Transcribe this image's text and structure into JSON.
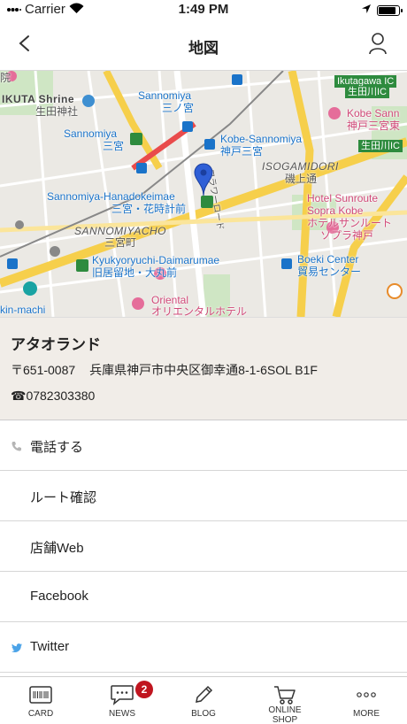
{
  "status_bar": {
    "carrier": "Carrier",
    "time": "1:49 PM",
    "battery_level": 0.9
  },
  "nav": {
    "title": "地図",
    "back_icon": "chevron-left-icon",
    "profile_icon": "person-icon"
  },
  "map": {
    "labels": {
      "ikuta_shrine": "IKUTA Shrine",
      "ikuta_shrine_ja": "生田神社",
      "sannomiya": "Sannomiya",
      "sannomiya_ja": "三ノ宮",
      "sannomiya2": "Sannomiya",
      "sannomiya2_ja": "三宮",
      "kobe_sannomiya": "Kobe-Sannomiya",
      "kobe_sannomiya_ja": "神戸三宮",
      "hanadokeimae": "Sannomiya-Hanadokeimae",
      "hanadokeimae_ja": "三宮・花時計前",
      "sannomiyacho": "SANNOMIYACHO",
      "sannomiyacho_ja": "三宮町",
      "kyukyoryuchi": "Kyukyoryuchi-Daimarumae",
      "kyukyoryuchi_ja": "旧居留地・大丸前",
      "isogamidori": "ISOGAMIDORI",
      "isogamidori_ja": "磯上通",
      "hotel_sunroute": "Hotel Sunroute",
      "hotel_sunroute2": "Sopra Kobe",
      "hotel_sunroute_ja": "ホテルサンルート",
      "hotel_sunroute_ja2": "ソプラ神戸",
      "boeki_center": "Boeki Center",
      "boeki_center_ja": "貿易センター",
      "oriental": "Oriental",
      "oriental_ja": "オリエンタルホテル",
      "kobe_sann": "Kobe Sann",
      "kobe_sann_ja": "神戸三宮東",
      "ikutagawa_ic": "Ikutagawa IC",
      "ikutagawa_ic_ja": "生田川IC",
      "ikutagawa_ic_box": "生田川IC",
      "in_machi": "kin-machi",
      "road": "フラワーロード",
      "kobe_hospital_prefix": "院"
    }
  },
  "shop": {
    "name": "アタオランド",
    "postal": "〒651-0087",
    "address": "兵庫県神戸市中央区御幸通8-1-6SOL B1F",
    "phone": "☎0782303380"
  },
  "actions": [
    {
      "label": "電話する",
      "icon": "phone-icon"
    },
    {
      "label": "ルート確認",
      "icon": ""
    },
    {
      "label": "店舗Web",
      "icon": ""
    },
    {
      "label": "Facebook",
      "icon": ""
    },
    {
      "label": "Twitter",
      "icon": "twitter-bird-icon"
    }
  ],
  "tabs": [
    {
      "label": "CARD",
      "icon": "card-icon"
    },
    {
      "label": "NEWS",
      "icon": "chat-icon",
      "badge": "2"
    },
    {
      "label": "BLOG",
      "icon": "pencil-icon"
    },
    {
      "label_line1": "ONLINE",
      "label_line2": "SHOP",
      "icon": "cart-icon"
    },
    {
      "label": "MORE",
      "icon": "dots-icon"
    }
  ],
  "colors": {
    "accent_blue": "#1a73c9",
    "badge_red": "#c0151f",
    "info_bg": "#f1ede8",
    "road_yellow": "#f6cf4b",
    "station_green": "#2e8b3e"
  }
}
